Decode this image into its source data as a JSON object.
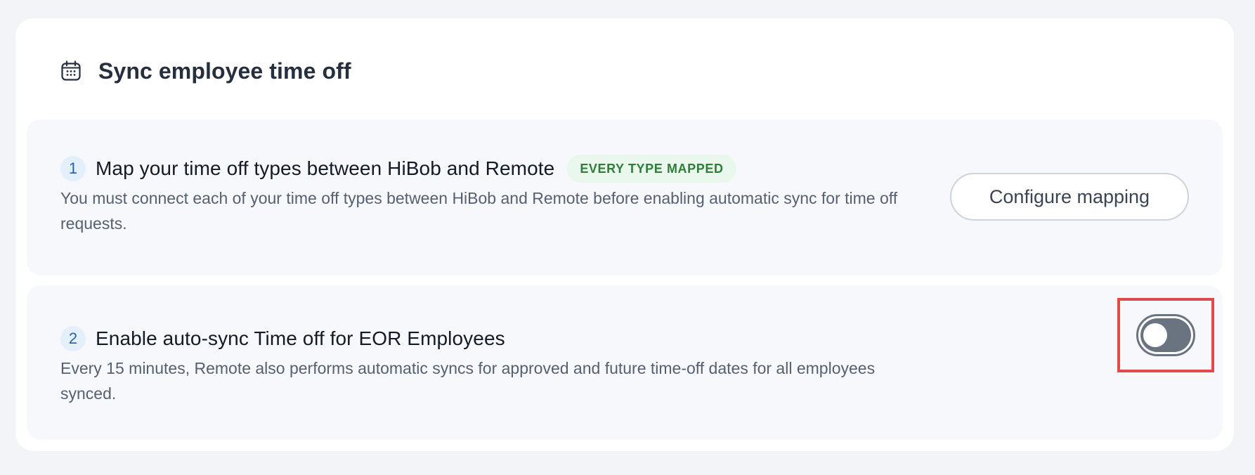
{
  "header": {
    "icon": "calendar-icon",
    "title": "Sync employee time off"
  },
  "steps": [
    {
      "number": "1",
      "title": "Map your time off types between HiBob and Remote",
      "badge": "EVERY TYPE MAPPED",
      "description": "You must connect each of your time off types between HiBob and Remote before enabling automatic sync for time off requests.",
      "action_label": "Configure mapping"
    },
    {
      "number": "2",
      "title": "Enable auto-sync Time off for EOR Employees",
      "description": "Every 15 minutes, Remote also performs automatic syncs for approved and future time-off dates for all employees synced.",
      "toggle_state": "off"
    }
  ],
  "colors": {
    "badge_bg": "#e9f7ec",
    "badge_text": "#2f7d3a",
    "step_number_bg": "#e4effc",
    "toggle_off": "#6a7380",
    "highlight": "#e04a4a"
  }
}
